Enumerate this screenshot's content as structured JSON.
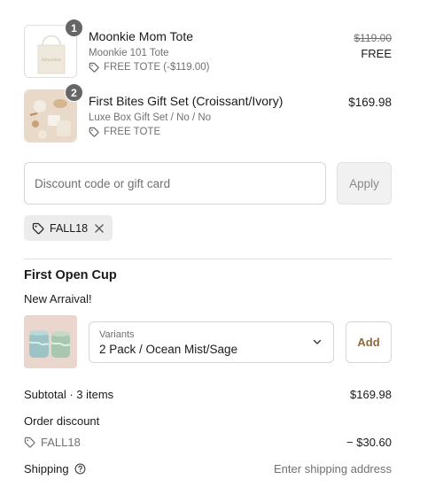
{
  "line_items": [
    {
      "quantity": "1",
      "title": "Moonkie Mom Tote",
      "variant": "Moonkie 101 Tote",
      "discount": "FREE TOTE (-$119.00)",
      "original_price": "$119.00",
      "price": "FREE",
      "thumb_text": "Moonkie"
    },
    {
      "quantity": "2",
      "title": "First Bites Gift Set (Croissant/Ivory)",
      "variant": "Luxe Box Gift Set / No / No",
      "discount": "FREE TOTE",
      "price": "$169.98"
    }
  ],
  "discount_form": {
    "placeholder": "Discount code or gift card",
    "apply_label": "Apply"
  },
  "applied_code": "FALL18",
  "upsell": {
    "title": "First Open Cup",
    "subtitle": "New Arraival!",
    "variant_label": "Variants",
    "variant_value": "2 Pack / Ocean Mist/Sage",
    "add_label": "Add"
  },
  "summary": {
    "subtotal_label": "Subtotal · 3 items",
    "subtotal_value": "$169.98",
    "order_discount_label": "Order discount",
    "discount_code": "FALL18",
    "discount_value": "− $30.60",
    "shipping_label": "Shipping",
    "shipping_value": "Enter shipping address"
  },
  "icons": {
    "tag": "tag-icon",
    "remove": "close-icon",
    "chevron": "chevron-down-icon",
    "help": "help-circle-icon"
  },
  "colors": {
    "accent": "#8b6a3d",
    "badge": "#666666",
    "muted_text": "#707070",
    "chip_bg": "#ececec"
  }
}
